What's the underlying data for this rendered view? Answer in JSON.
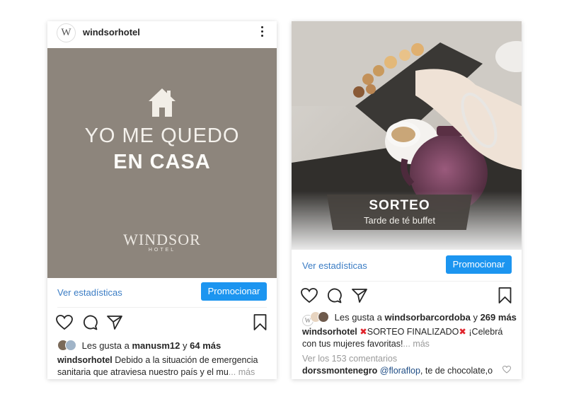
{
  "post1": {
    "username": "windsorhotel",
    "avatar_letter": "W",
    "promo_line1": "YO ME QUEDO",
    "promo_line2": "EN CASA",
    "brand_name": "WINDSOR",
    "brand_sub": "HOTEL",
    "stats_link": "Ver estadísticas",
    "promote_button": "Promocionar",
    "likes_prefix": "Les gusta a",
    "likes_user": "manusm12",
    "likes_and": "y",
    "likes_more": "64 más",
    "caption_user": "windsorhotel",
    "caption_text": "Debido a la situación de emergencia sanitaria que atraviesa nuestro país y el mu",
    "caption_more": "... más",
    "image_bg_color": "#8d857c"
  },
  "post2": {
    "banner_title": "SORTEO",
    "banner_subtitle": "Tarde de té buffet",
    "stats_link": "Ver estadísticas",
    "promote_button": "Promocionar",
    "likes_prefix": "Les gusta a",
    "likes_user": "windsorbarcordoba",
    "likes_and": "y",
    "likes_more": "269 más",
    "caption_user": "windsorhotel",
    "caption_text_a": "SORTEO FINALIZADO",
    "caption_text_b": "¡Celebrá con tus mujeres favoritas!",
    "caption_more": "... más",
    "caption_mark": "✖",
    "view_comments": "Ver los 153 comentarios",
    "comment_user": "dorssmontenegro",
    "comment_mention": "@floraflop",
    "comment_text": ", te de chocolate,o"
  },
  "icons": [
    "heart-icon",
    "comment-icon",
    "share-icon",
    "bookmark-icon",
    "more-options-icon",
    "house-icon"
  ],
  "colors": {
    "accent": "#1c95f0",
    "link": "#3a7cc4",
    "mark_red": "#e0242c"
  }
}
